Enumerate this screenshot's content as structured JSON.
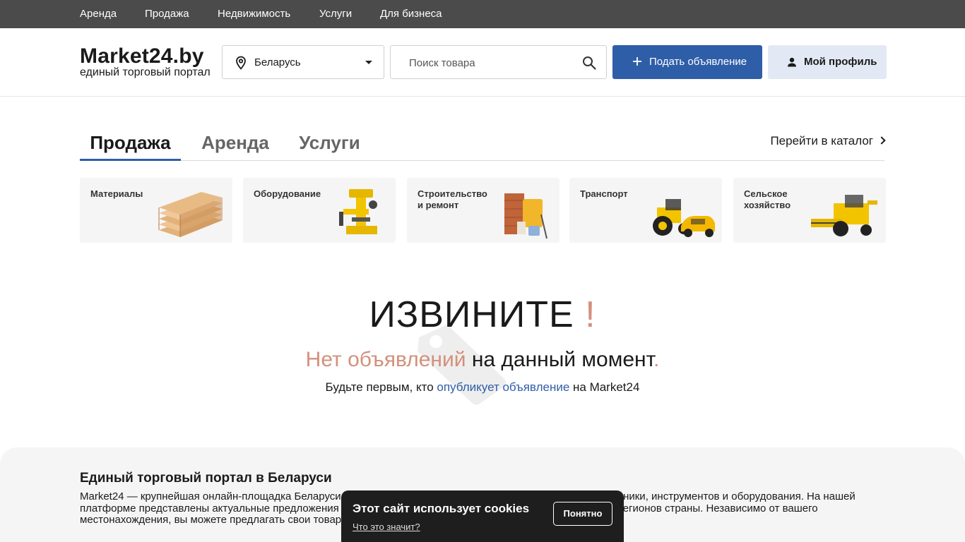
{
  "topnav": {
    "items": [
      {
        "label": "Аренда"
      },
      {
        "label": "Продажа"
      },
      {
        "label": "Недвижимость"
      },
      {
        "label": "Услуги"
      },
      {
        "label": "Для бизнеса"
      }
    ]
  },
  "header": {
    "logo_title": "Market24.by",
    "logo_subtitle": "единый торговый портал",
    "region": {
      "label": "Беларусь",
      "icon": "location-pin-icon"
    },
    "search": {
      "placeholder": "Поиск товара",
      "value": "",
      "icon": "search-icon"
    },
    "post_button": {
      "label": "Подать объявление",
      "icon": "plus-icon"
    },
    "profile_button": {
      "label": "Мой профиль",
      "icon": "user-icon"
    }
  },
  "tabs": {
    "items": [
      {
        "label": "Продажа",
        "active": true
      },
      {
        "label": "Аренда",
        "active": false
      },
      {
        "label": "Услуги",
        "active": false
      }
    ],
    "catalog_link": "Перейти в каталог"
  },
  "categories": [
    {
      "label": "Материалы",
      "icon": "lumber-image"
    },
    {
      "label": "Оборудование",
      "icon": "drill-press-image"
    },
    {
      "label": "Строительство и ремонт",
      "icon": "building-supplies-image"
    },
    {
      "label": "Транспорт",
      "icon": "tractor-taxi-image"
    },
    {
      "label": "Сельское хозяйство",
      "icon": "combine-harvester-image"
    }
  ],
  "empty_state": {
    "title": "ИЗВИНИТЕ",
    "title_mark": "!",
    "subtitle_accent": "Нет объявлений",
    "subtitle_rest": " на данный момент",
    "subtitle_dot": ".",
    "line_before": "Будьте первым, кто ",
    "line_link": "опубликует объявление",
    "line_after": " на Market24"
  },
  "info": {
    "heading": "Единый торговый портал в Беларуси",
    "text": "Market24 — крупнейшая онлайн-площадка Беларуси для размещения объявлений продажи строительной техники, инструментов и оборудования. На нашей платформе представлены актуальные предложения техники и инструмента от надежных продавцов из всех регионов страны. Независимо от вашего местонахождения, вы можете предлагать свои товары покупателям, которые находятся рядом с вами."
  },
  "cookie": {
    "title": "Этот сайт использует cookies",
    "more_link": "Что это значит?",
    "accept_button": "Понятно"
  },
  "colors": {
    "topnav_bg": "#4b4b4b",
    "primary": "#2f5ea8",
    "accent": "#d4907c",
    "profile_bg": "#e3e9f4"
  }
}
